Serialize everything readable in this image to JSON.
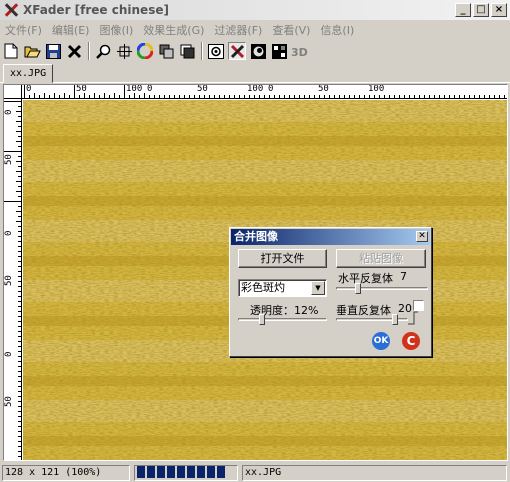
{
  "window": {
    "title": "XFader [free chinese]",
    "minimize": "_",
    "maximize": "□",
    "close": "×"
  },
  "menu": [
    {
      "label": "文件(F)"
    },
    {
      "label": "编辑(E)"
    },
    {
      "label": "图像(I)"
    },
    {
      "label": "效果生成(G)"
    },
    {
      "label": "过滤器(F)"
    },
    {
      "label": "查看(V)"
    },
    {
      "label": "信息(I)"
    }
  ],
  "toolbar": {
    "icons": [
      "new-file-icon",
      "open-folder-icon",
      "save-disk-icon",
      "delete-x-icon",
      "zoom-magnifier-icon",
      "crosshair-icon",
      "color-wheel-icon",
      "layers-icon",
      "overlay-icon",
      "blend-icon",
      "fader-x-icon",
      "swirl-icon",
      "tile-icon",
      "3d-icon"
    ]
  },
  "tab": {
    "label": "xx.JPG"
  },
  "rulers": {
    "horizontal": [
      "0",
      "50",
      "100",
      "0",
      "50",
      "100",
      "0",
      "50",
      "100"
    ],
    "vertical": [
      "0",
      "50",
      "0",
      "50",
      "0",
      "50",
      "0"
    ]
  },
  "dialog": {
    "title": "合并图像",
    "open_file": "打开文件",
    "paste_image": "粘贴图像",
    "blend_mode": "彩色斑灼",
    "horizontal_repeat_label": "水平反复体",
    "horizontal_repeat_value": "7",
    "transparency_label": "透明度：12%",
    "transparency_value": 12,
    "vertical_repeat_label": "垂直反复体",
    "vertical_repeat_value": "20",
    "ok": "OK",
    "cancel": "C"
  },
  "status": {
    "size": "128 x 121 (100%)",
    "progress_segments": 9,
    "file": "xx.JPG"
  },
  "colors": {
    "image": "#d3b13a",
    "title_active": "#0a246a",
    "ok": "#2a6ed6",
    "cancel": "#d0321c"
  }
}
